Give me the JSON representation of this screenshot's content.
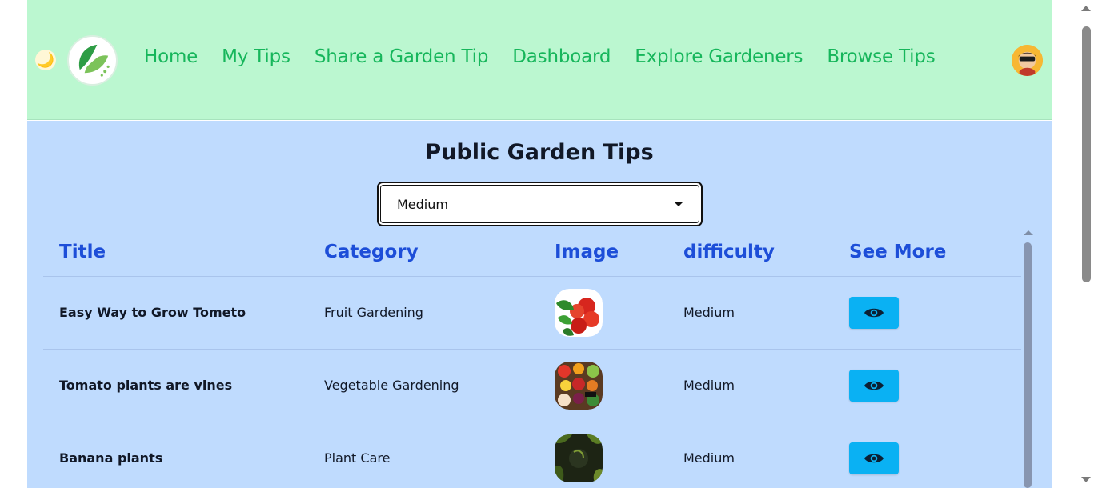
{
  "nav": {
    "links": [
      "Home",
      "My Tips",
      "Share a Garden Tip",
      "Dashboard",
      "Explore Gardeners",
      "Browse Tips"
    ],
    "theme_icon": "moon-icon",
    "logo_icon": "leaf-logo",
    "avatar_icon": "user-avatar"
  },
  "main": {
    "title": "Public Garden Tips",
    "filter": {
      "selected": "Medium"
    },
    "table": {
      "headers": [
        "Title",
        "Category",
        "Image",
        "difficulty",
        "See More"
      ],
      "rows": [
        {
          "title": "Easy Way to Grow Tometo",
          "category": "Fruit Gardening",
          "image_icon": "tomato-photo",
          "difficulty": "Medium",
          "action_icon": "eye-icon"
        },
        {
          "title": "Tomato plants are vines",
          "category": "Vegetable Gardening",
          "image_icon": "vegetables-photo",
          "difficulty": "Medium",
          "action_icon": "eye-icon"
        },
        {
          "title": "Banana plants",
          "category": "Plant Care",
          "image_icon": "banana-plant-photo",
          "difficulty": "Medium",
          "action_icon": "eye-icon"
        }
      ]
    }
  },
  "colors": {
    "header_bg": "#bbf7d0",
    "nav_link": "#16b65b",
    "main_bg": "#bfdbfe",
    "table_header": "#1d4ed8",
    "button": "#0ab1f3"
  }
}
